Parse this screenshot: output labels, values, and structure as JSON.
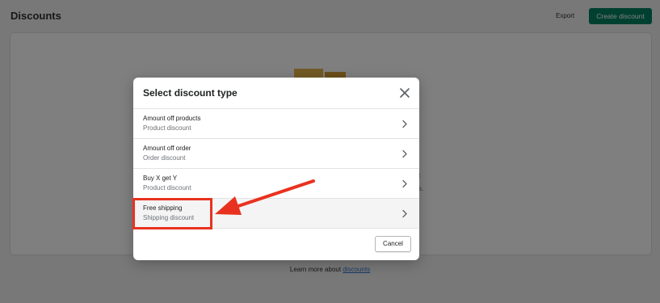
{
  "header": {
    "title": "Discounts",
    "export_label": "Export",
    "create_label": "Create discount"
  },
  "background": {
    "partial_text_1": "t",
    "partial_text_2": "s.",
    "learn_more_prefix": "Learn more about",
    "learn_more_link": "discounts"
  },
  "modal": {
    "title": "Select discount type",
    "options": [
      {
        "title": "Amount off products",
        "subtitle": "Product discount"
      },
      {
        "title": "Amount off order",
        "subtitle": "Order discount"
      },
      {
        "title": "Buy X get Y",
        "subtitle": "Product discount"
      },
      {
        "title": "Free shipping",
        "subtitle": "Shipping discount"
      }
    ],
    "cancel_label": "Cancel"
  },
  "colors": {
    "primary": "#008060",
    "annotation": "#e8321f",
    "link": "#2c6ecb"
  },
  "icons": {
    "close": "close-icon",
    "chevron": "chevron-right-icon"
  }
}
